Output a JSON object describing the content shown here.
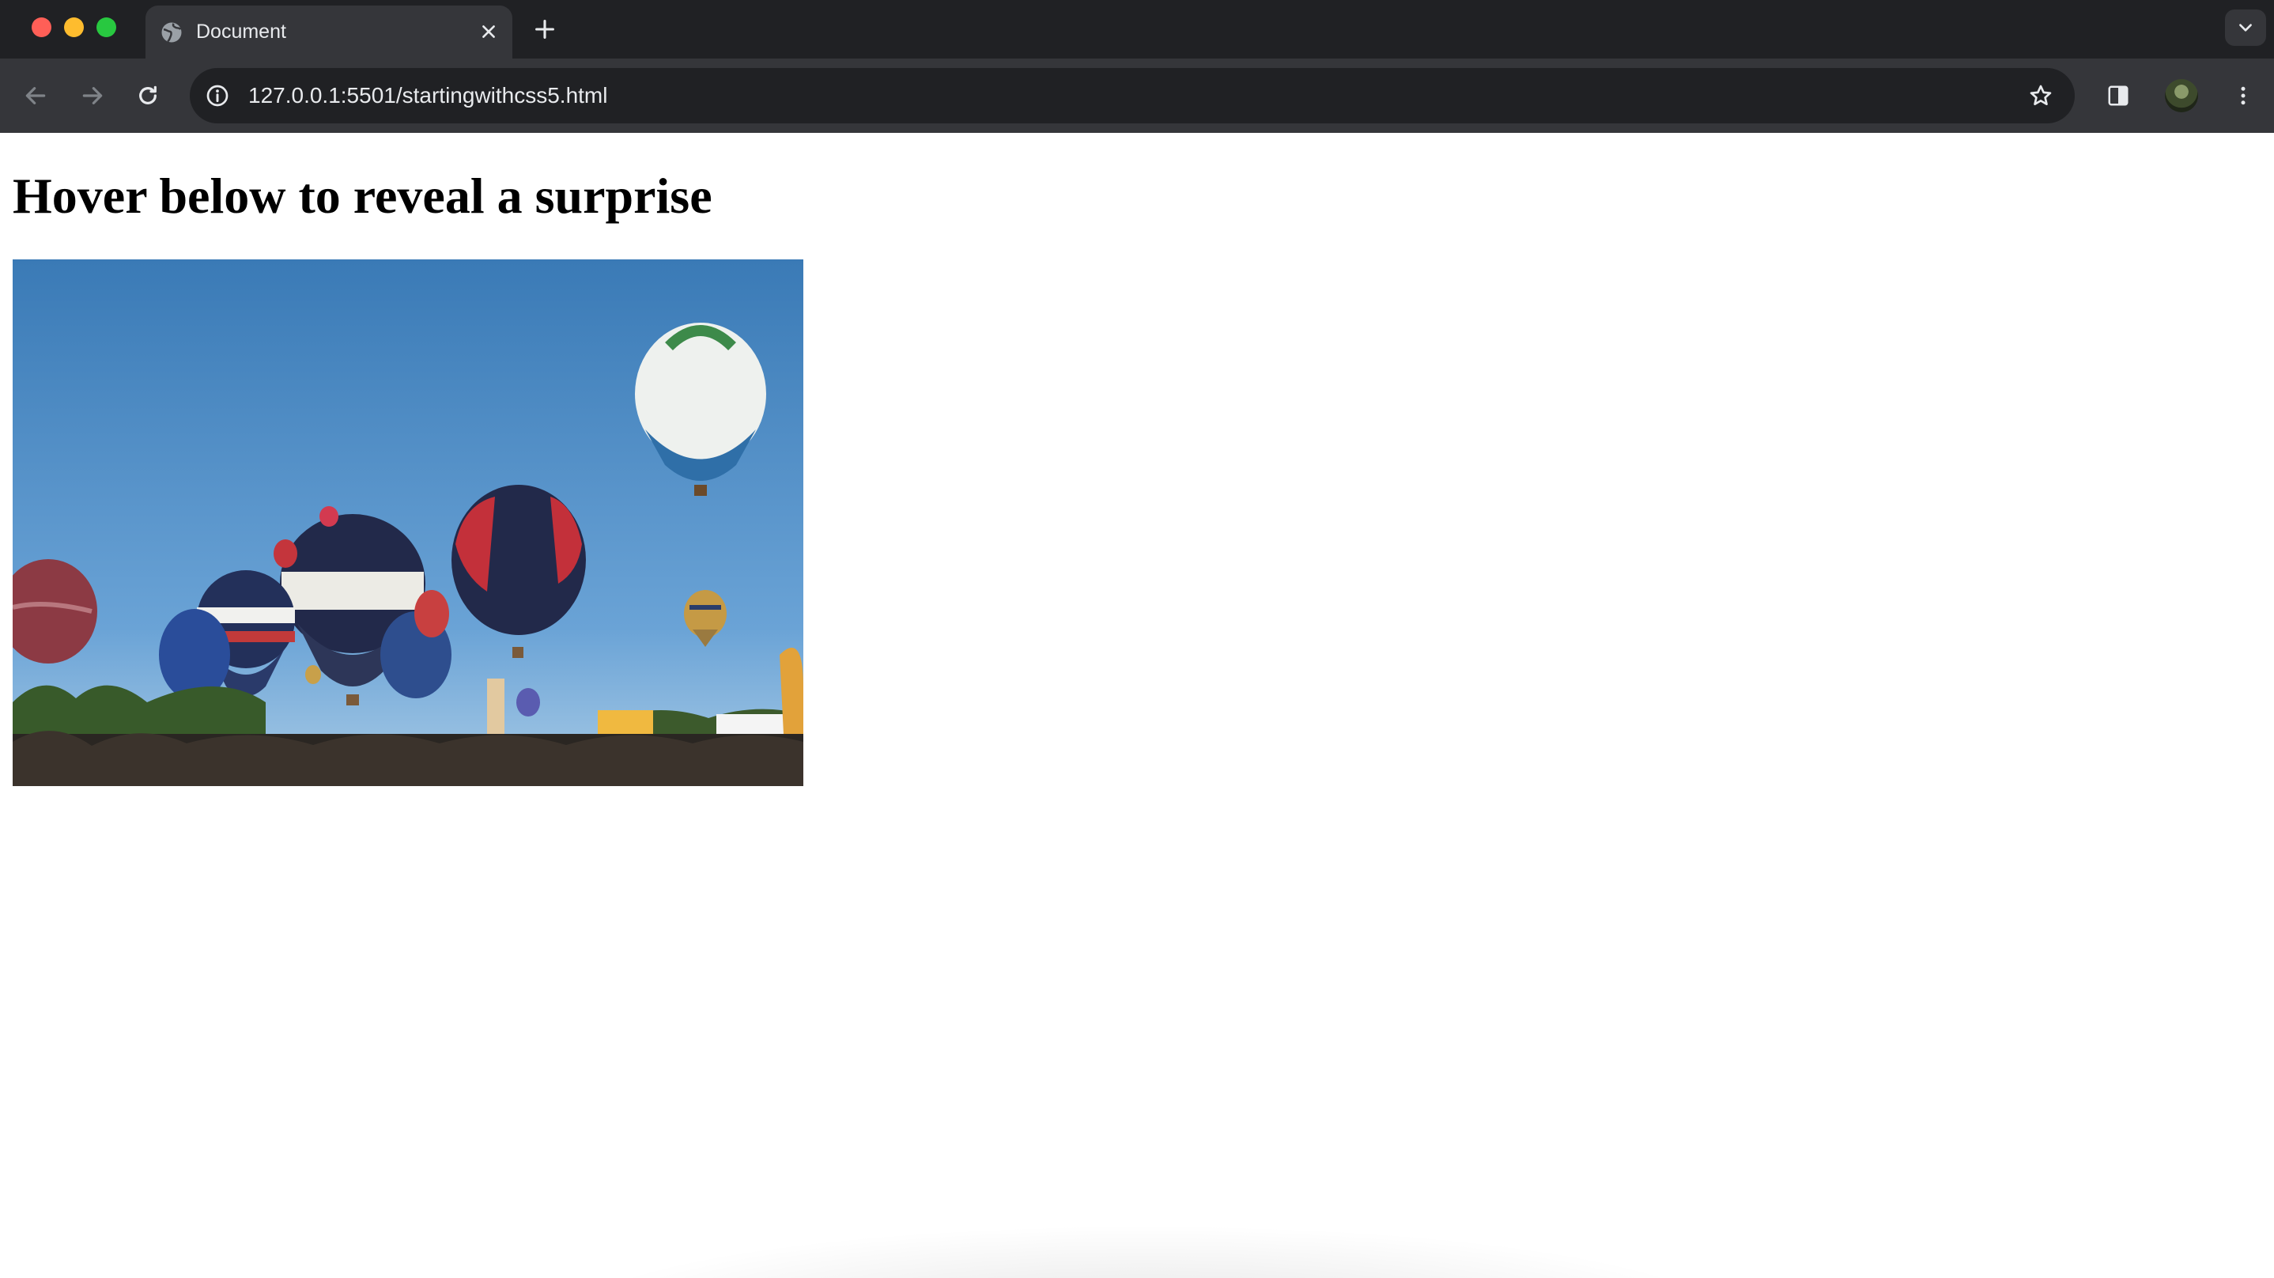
{
  "window": {
    "controls": [
      "close",
      "minimize",
      "maximize"
    ]
  },
  "tab": {
    "title": "Document",
    "favicon": "globe-icon"
  },
  "toolbar": {
    "url": "127.0.0.1:5501/startingwithcss5.html",
    "icons": [
      "back-icon",
      "forward-icon",
      "reload-icon",
      "site-info-icon",
      "bookmark-star-icon",
      "side-panel-icon",
      "profile-avatar",
      "more-menu-icon"
    ]
  },
  "page": {
    "heading": "Hover below to reveal a surprise",
    "image_alt": "hot-air-balloons-photo"
  },
  "colors": {
    "chrome_dark": "#202124",
    "chrome_toolbar": "#35363a",
    "chrome_text": "#e8eaed",
    "sky_top": "#3b7db8",
    "sky_bottom": "#86b6df"
  }
}
